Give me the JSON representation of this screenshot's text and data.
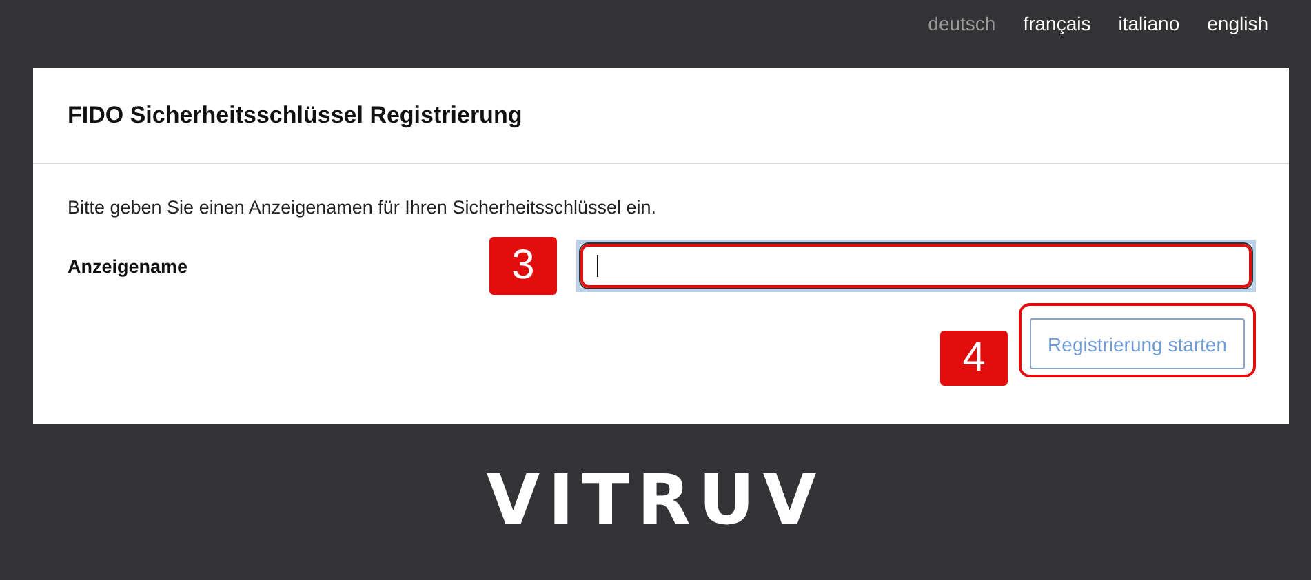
{
  "languages": [
    {
      "label": "deutsch",
      "selected": true
    },
    {
      "label": "français",
      "selected": false
    },
    {
      "label": "italiano",
      "selected": false
    },
    {
      "label": "english",
      "selected": false
    }
  ],
  "card": {
    "title": "FIDO Sicherheitsschlüssel Registrierung",
    "instruction": "Bitte geben Sie einen Anzeigenamen für Ihren Sicherheitsschlüssel ein.",
    "field": {
      "label": "Anzeigename",
      "step": "3",
      "focused": true
    },
    "button": {
      "label": "Registrierung starten",
      "step": "4"
    }
  },
  "logo": "VITRUV"
}
